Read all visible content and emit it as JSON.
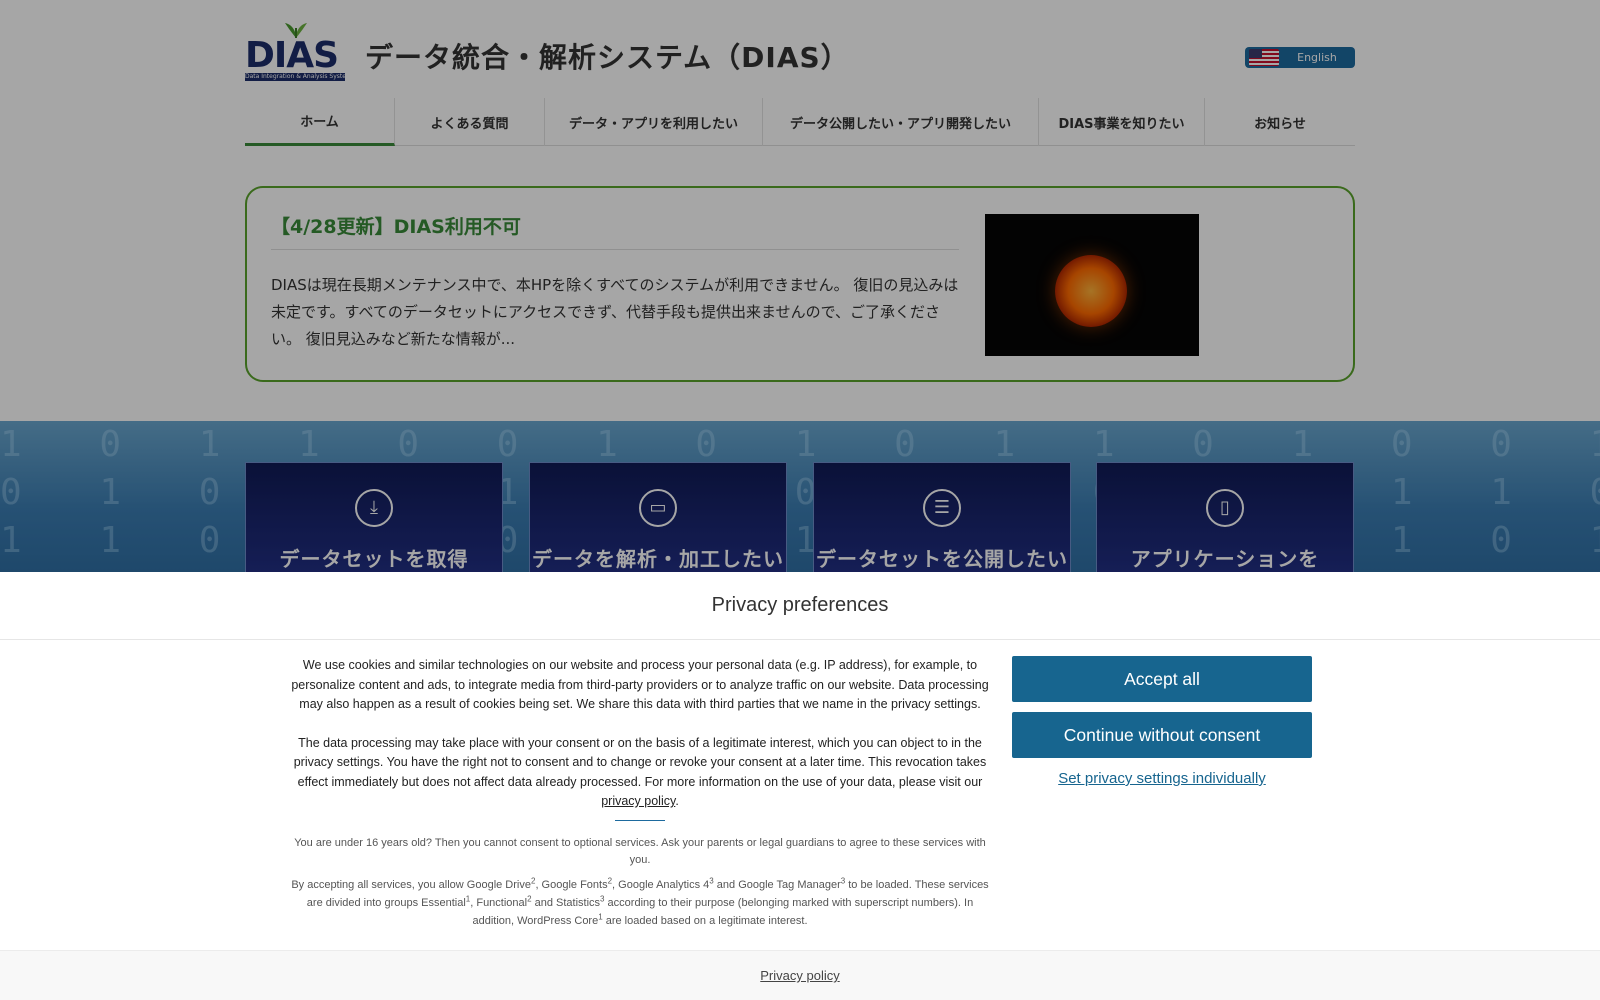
{
  "header": {
    "logo_text": "DIAS",
    "logo_subtext": "Data Integration & Analysis System",
    "site_title": "データ統合・解析システム（DIAS）",
    "language_button": "English"
  },
  "nav": {
    "items": [
      {
        "label": "ホーム"
      },
      {
        "label": "よくある質問"
      },
      {
        "label": "データ・アプリを利用したい"
      },
      {
        "label": "データ公開したい・アプリ開発したい"
      },
      {
        "label": "DIAS事業を知りたい"
      },
      {
        "label": "お知らせ"
      }
    ]
  },
  "news": {
    "title": "【4/28更新】DIAS利用不可",
    "body": "DIASは現在長期メンテナンス中で、本HPを除くすべてのシステムが利用できません。 復旧の見込みは未定です。すべてのデータセットにアクセスできず、代替手段も提供出来ませんので、ご了承ください。 復旧見込みなど新たな情報が..."
  },
  "tiles": [
    {
      "label": "データセットを取得",
      "icon": "download-icon"
    },
    {
      "label": "データを解析・加工したい",
      "icon": "computer-icon"
    },
    {
      "label": "データセットを公開したい",
      "icon": "list-icon"
    },
    {
      "label": "アプリケーションを",
      "icon": "tablet-icon"
    }
  ],
  "consent": {
    "title": "Privacy preferences",
    "paragraph1": "We use cookies and similar technologies on our website and process your personal data (e.g. IP address), for example, to personalize content and ads, to integrate media from third-party providers or to analyze traffic on our website. Data processing may also happen as a result of cookies being set. We share this data with third parties that we name in the privacy settings.",
    "paragraph2_before": "The data processing may take place with your consent or on the basis of a legitimate interest, which you can object to in the privacy settings. You have the right not to consent and to change or revoke your consent at a later time. This revocation takes effect immediately but does not affect data already processed. For more information on the use of your data, please visit our ",
    "paragraph2_link": "privacy policy",
    "paragraph2_after": ".",
    "paragraph3": "You are under 16 years old? Then you cannot consent to optional services. Ask your parents or legal guardians to agree to these services with you.",
    "p4": {
      "t1": "By accepting all services, you allow Google Drive",
      "s1": "2",
      "t2": ", Google Fonts",
      "s2": "2",
      "t3": ", Google Analytics 4",
      "s3": "3",
      "t4": " and Google Tag Manager",
      "s4": "3",
      "t5": " to be loaded. These services are divided into groups Essential",
      "s5": "1",
      "t6": ", Functional",
      "s6": "2",
      "t7": " and Statistics",
      "s7": "3",
      "t8": " according to their purpose (belonging marked with superscript numbers). In addition, WordPress Core",
      "s8": "1",
      "t9": " are loaded based on a legitimate interest."
    },
    "accept_all": "Accept all",
    "continue_without": "Continue without consent",
    "individual_settings": "Set privacy settings individually",
    "footer_link": "Privacy policy"
  },
  "colors": {
    "accent_button": "#17658f",
    "news_border": "#5aa32b",
    "news_title": "#3a8a3a",
    "tile_bg": "#1b2670"
  }
}
